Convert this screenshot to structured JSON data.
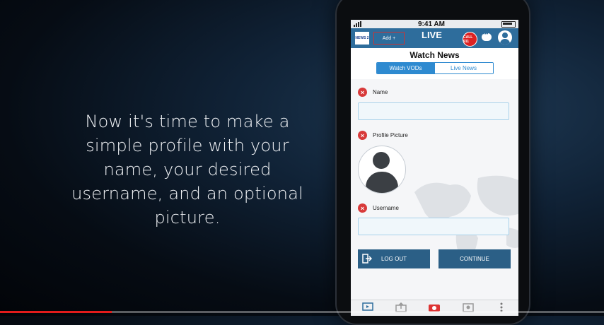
{
  "caption": "Now it's time to make a simple profile with your name, your desired username, and an optional picture.",
  "status": {
    "time": "9:41 AM"
  },
  "appbar": {
    "news_logo": "NEWS 2",
    "add_button": "Add +",
    "live_logo": "LIVE",
    "call_label": "CALL 911"
  },
  "page_title": "Watch News",
  "segments": {
    "watch_vods": "Watch VODs",
    "live_news": "Live News"
  },
  "form": {
    "name_label": "Name",
    "name_value": "",
    "picture_label": "Profile Picture",
    "username_label": "Username",
    "username_value": "",
    "logout": "LOG OUT",
    "continue": "CONTINUE"
  },
  "progress": 0.185,
  "colors": {
    "accent": "#2e6d9c",
    "button": "#2b5f86",
    "error": "#d83a3a",
    "progress": "#e21b1b"
  }
}
